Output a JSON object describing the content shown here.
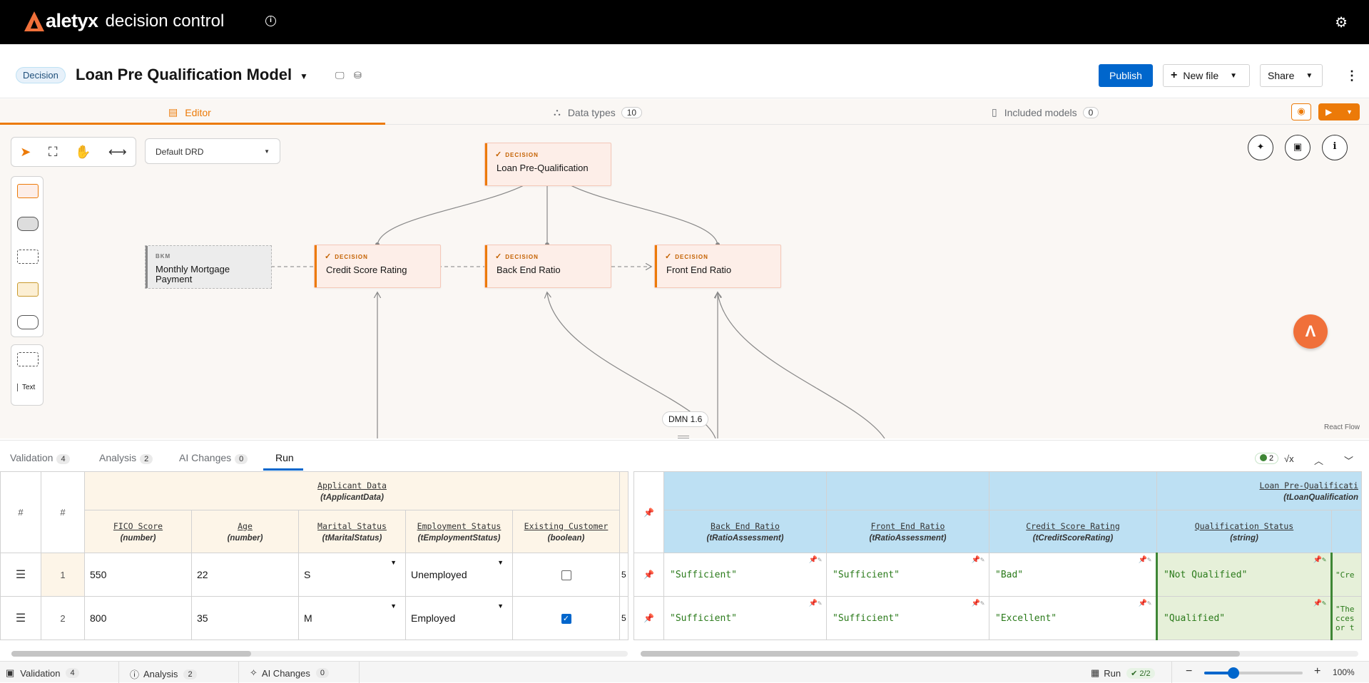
{
  "app": {
    "logo": "aletyx",
    "product": "decision control"
  },
  "header": {
    "badge": "Decision",
    "title": "Loan Pre Qualification Model",
    "publish": "Publish",
    "new_file": "New file",
    "share": "Share"
  },
  "tabs": {
    "editor": "Editor",
    "data_types": "Data types",
    "data_types_count": "10",
    "included_models": "Included models",
    "included_count": "0"
  },
  "canvas": {
    "drd_select": "Default DRD",
    "palette_text": "Text",
    "dmn_version": "DMN 1.6",
    "react_flow": "React Flow",
    "nodes": {
      "root": {
        "kind": "DECISION",
        "label": "Loan Pre-Qualification"
      },
      "credit": {
        "kind": "DECISION",
        "label": "Credit Score Rating"
      },
      "backend": {
        "kind": "DECISION",
        "label": "Back End Ratio"
      },
      "frontend": {
        "kind": "DECISION",
        "label": "Front End Ratio"
      },
      "bkm": {
        "kind": "BKM",
        "label": "Monthly Mortgage Payment"
      }
    }
  },
  "panel": {
    "tabs": [
      {
        "label": "Validation",
        "count": "4"
      },
      {
        "label": "Analysis",
        "count": "2"
      },
      {
        "label": "AI Changes",
        "count": "0"
      },
      {
        "label": "Run"
      }
    ],
    "ok_count": "2",
    "input_table": {
      "row_hash": "#",
      "group_label": "Applicant Data",
      "group_type": "(tApplicantData)",
      "columns": [
        {
          "name": "FICO Score",
          "type": "(number)"
        },
        {
          "name": "Age",
          "type": "(number)"
        },
        {
          "name": "Marital Status",
          "type": "(tMaritalStatus)"
        },
        {
          "name": "Employment Status",
          "type": "(tEmploymentStatus)"
        },
        {
          "name": "Existing Customer",
          "type": "(boolean)"
        }
      ],
      "rows": [
        {
          "idx": "1",
          "fico": "550",
          "age": "22",
          "marital": "S",
          "employment": "Unemployed",
          "existing": false,
          "next": "5"
        },
        {
          "idx": "2",
          "fico": "800",
          "age": "35",
          "marital": "M",
          "employment": "Employed",
          "existing": true,
          "next": "5"
        }
      ]
    },
    "output_table": {
      "group_label": "Loan Pre-Qualificati",
      "group_type": "(tLoanQualification",
      "columns": [
        {
          "name": "Back End Ratio",
          "type": "(tRatioAssessment)"
        },
        {
          "name": "Front End Ratio",
          "type": "(tRatioAssessment)"
        },
        {
          "name": "Credit Score Rating",
          "type": "(tCreditScoreRating)"
        },
        {
          "name": "Qualification Status",
          "type": "(string)"
        }
      ],
      "rows": [
        {
          "backend": "\"Sufficient\"",
          "frontend": "\"Sufficient\"",
          "credit": "\"Bad\"",
          "status": "\"Not Qualified\"",
          "extra": "\"Cre"
        },
        {
          "backend": "\"Sufficient\"",
          "frontend": "\"Sufficient\"",
          "credit": "\"Excellent\"",
          "status": "\"Qualified\"",
          "extra": "\"The\ncces\nor t"
        }
      ]
    }
  },
  "statusbar": {
    "validation": "Validation",
    "validation_count": "4",
    "analysis": "Analysis",
    "analysis_count": "2",
    "ai_changes": "AI Changes",
    "ai_changes_count": "0",
    "run": "Run",
    "run_result": "2/2",
    "zoom": "100%",
    "zoom_level": 0.3
  },
  "colors": {
    "accent": "#ec7a08",
    "brand": "#f0703a",
    "primary": "#0066cc",
    "success": "#3e8635"
  }
}
